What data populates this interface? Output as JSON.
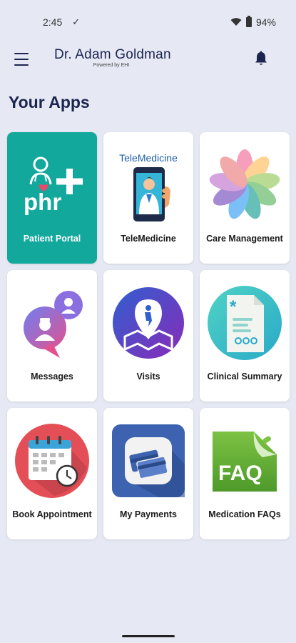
{
  "status_bar": {
    "time": "2:45",
    "battery": "94%"
  },
  "app_bar": {
    "title": "Dr. Adam Goldman",
    "subtitle": "Powered by EHI"
  },
  "section_title": "Your Apps",
  "apps": [
    {
      "label": "Patient Portal",
      "icon": "phr-icon",
      "logo_text": "phr",
      "color": "#12a89c"
    },
    {
      "label": "TeleMedicine",
      "icon": "telemedicine-icon",
      "logo_text": "TeleMedicine"
    },
    {
      "label": "Care Management",
      "icon": "care-management-icon"
    },
    {
      "label": "Messages",
      "icon": "messages-icon"
    },
    {
      "label": "Visits",
      "icon": "visits-icon"
    },
    {
      "label": "Clinical Summary",
      "icon": "clinical-summary-icon"
    },
    {
      "label": "Book Appointment",
      "icon": "book-appointment-icon"
    },
    {
      "label": "My Payments",
      "icon": "my-payments-icon"
    },
    {
      "label": "Medication FAQs",
      "icon": "medication-faqs-icon",
      "logo_text": "FAQ"
    }
  ]
}
